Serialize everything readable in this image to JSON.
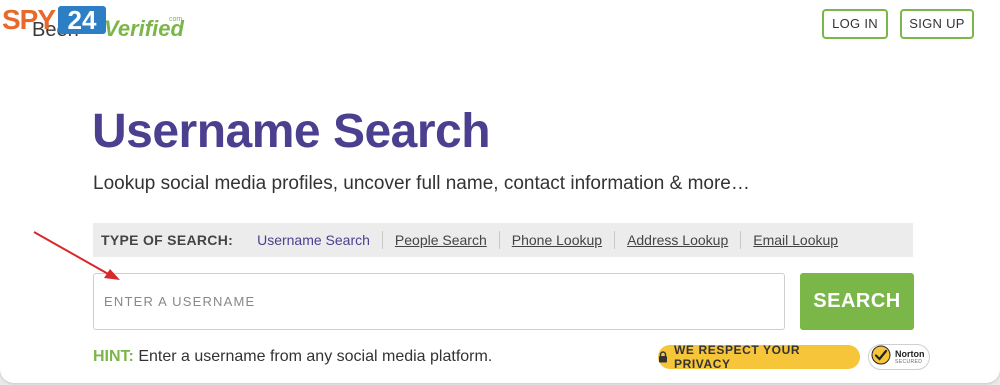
{
  "logo": {
    "spy": "SPY",
    "num": "24",
    "been": "Been",
    "verified": "Verified",
    "com": "com",
    "reg": "®"
  },
  "header": {
    "login_label": "LOG IN",
    "signup_label": "SIGN UP"
  },
  "main": {
    "title": "Username Search",
    "subtitle": "Lookup social media profiles, uncover full name, contact information & more…"
  },
  "search_types": {
    "label": "TYPE OF SEARCH:",
    "items": [
      {
        "label": "Username Search",
        "active": true
      },
      {
        "label": "People Search",
        "active": false
      },
      {
        "label": "Phone Lookup",
        "active": false
      },
      {
        "label": "Address Lookup",
        "active": false
      },
      {
        "label": "Email Lookup",
        "active": false
      }
    ]
  },
  "search": {
    "placeholder": "ENTER A USERNAME",
    "value": "",
    "button_label": "SEARCH"
  },
  "hint": {
    "label": "HINT:",
    "text": " Enter a username from any social media platform."
  },
  "badges": {
    "privacy": "WE RESPECT YOUR PRIVACY",
    "norton": "Norton",
    "norton_sub": "SECURED"
  },
  "colors": {
    "brand_purple": "#4b3f8f",
    "accent_green": "#7ab648",
    "privacy_yellow": "#f7c53a"
  }
}
